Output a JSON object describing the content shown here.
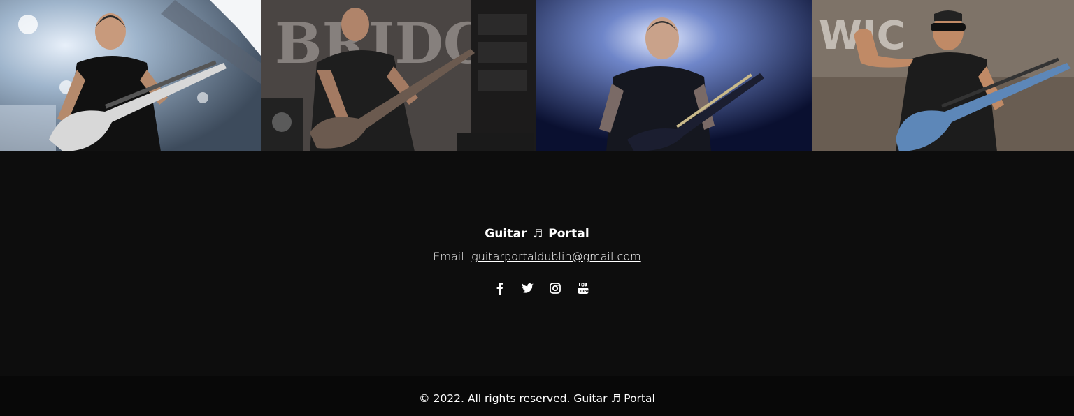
{
  "gallery": {
    "photos": [
      {
        "alt": "guitarist-1"
      },
      {
        "alt": "guitarist-2"
      },
      {
        "alt": "guitarist-3"
      },
      {
        "alt": "guitarist-4"
      }
    ]
  },
  "footer": {
    "brand_left": "Guitar",
    "brand_icon": "♬",
    "brand_right": "Portal",
    "email_label": "Email:",
    "email_address": "guitarportaldublin@gmail.com",
    "social_icons": [
      "facebook-icon",
      "twitter-icon",
      "instagram-icon",
      "youtube-icon"
    ]
  },
  "copyright": {
    "text": "© 2022. All rights reserved. Guitar",
    "icon": "♬",
    "brand_right": "Portal"
  },
  "colors": {
    "background": "#0d0d0d",
    "copyright_bar": "#080808",
    "text": "#ffffff"
  }
}
